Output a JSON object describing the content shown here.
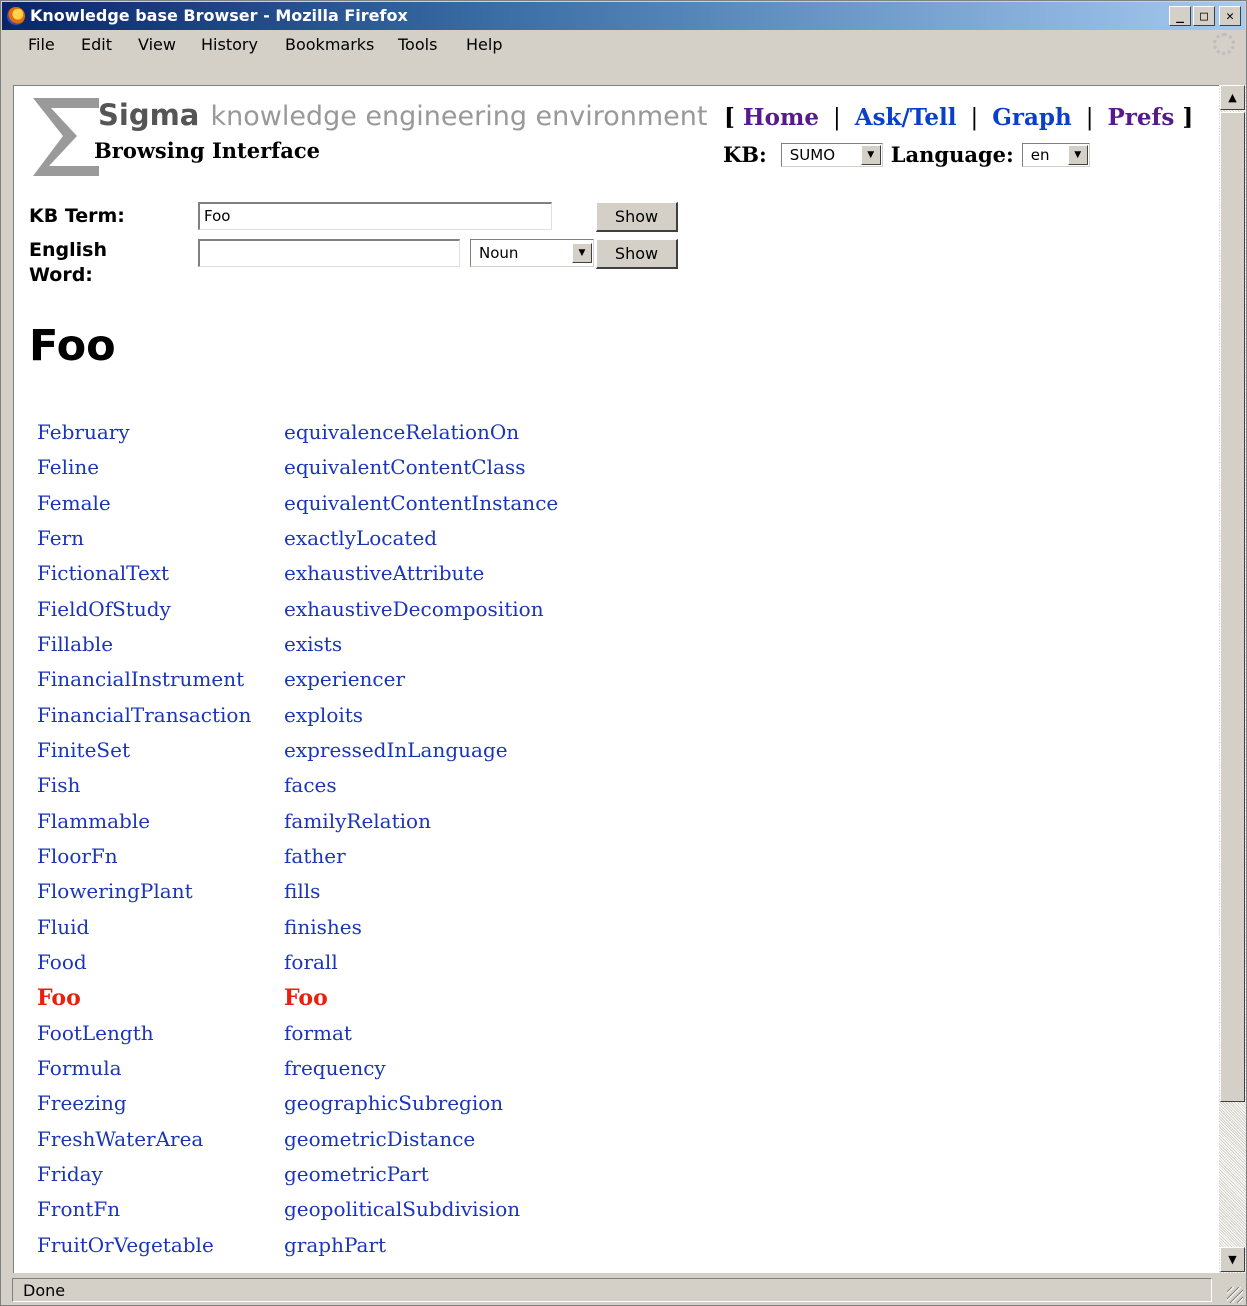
{
  "window": {
    "title": "Knowledge base Browser - Mozilla Firefox",
    "buttons": [
      "_",
      "□",
      "✕"
    ]
  },
  "menubar": {
    "items": [
      "File",
      "Edit",
      "View",
      "History",
      "Bookmarks",
      "Tools",
      "Help"
    ]
  },
  "header": {
    "brand_name": "Sigma",
    "brand_tagline": "knowledge engineering environment",
    "subtitle": "Browsing Interface",
    "nav": {
      "open_bracket": "[",
      "close_bracket": "]",
      "separator": "|",
      "items": [
        "Home",
        "Ask/Tell",
        "Graph",
        "Prefs"
      ]
    },
    "kb_label": "KB:",
    "kb_value": "SUMO",
    "language_label": "Language:",
    "language_value": "en"
  },
  "search": {
    "kb_term_label": "KB Term:",
    "kb_term_value": "Foo",
    "english_word_label": "English Word:",
    "english_word_value": "",
    "pos_value": "Noun",
    "show_label": "Show"
  },
  "term": {
    "heading": "Foo"
  },
  "term_list": {
    "left": [
      "February",
      "Feline",
      "Female",
      "Fern",
      "FictionalText",
      "FieldOfStudy",
      "Fillable",
      "FinancialInstrument",
      "FinancialTransaction",
      "FiniteSet",
      "Fish",
      "Flammable",
      "FloorFn",
      "FloweringPlant",
      "Fluid",
      "Food",
      "Foo",
      "FootLength",
      "Formula",
      "Freezing",
      "FreshWaterArea",
      "Friday",
      "FrontFn",
      "FruitOrVegetable"
    ],
    "right": [
      "equivalenceRelationOn",
      "equivalentContentClass",
      "equivalentContentInstance",
      "exactlyLocated",
      "exhaustiveAttribute",
      "exhaustiveDecomposition",
      "exists",
      "experiencer",
      "exploits",
      "expressedInLanguage",
      "faces",
      "familyRelation",
      "father",
      "fills",
      "finishes",
      "forall",
      "Foo",
      "format",
      "frequency",
      "geographicSubregion",
      "geometricDistance",
      "geometricPart",
      "geopoliticalSubdivision",
      "graphPart"
    ],
    "current_term": "Foo"
  },
  "statusbar": {
    "text": "Done"
  }
}
